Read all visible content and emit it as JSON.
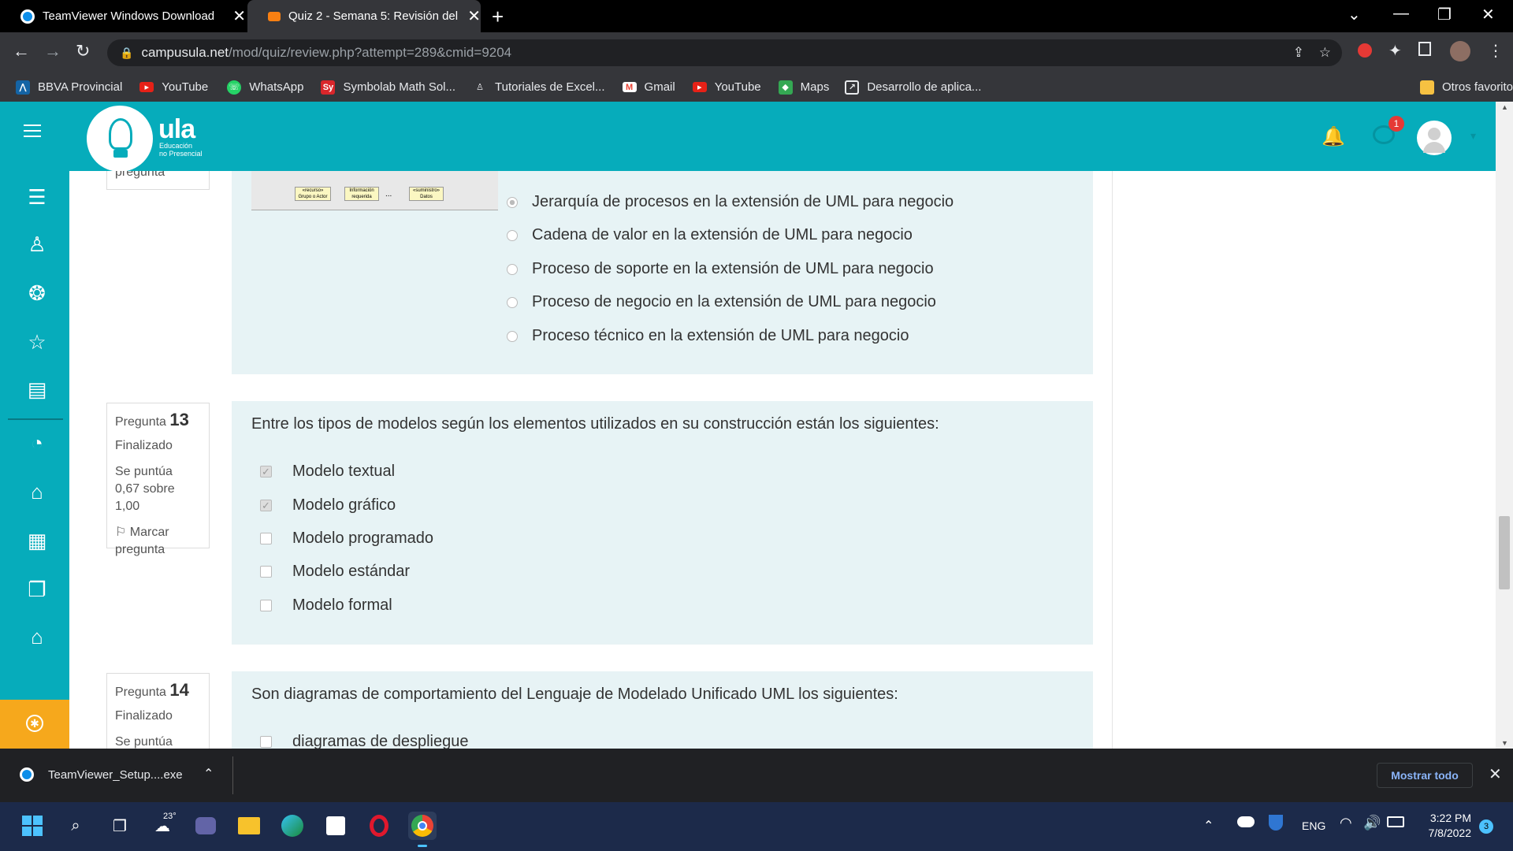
{
  "browser": {
    "tabs": [
      {
        "title": "TeamViewer Windows Download",
        "active": false
      },
      {
        "title": "Quiz 2 - Semana 5: Revisión del i",
        "active": true
      }
    ],
    "url_domain": "campusula.net",
    "url_path": "/mod/quiz/review.php?attempt=289&cmid=9204",
    "bookmarks": [
      {
        "label": "BBVA Provincial",
        "icon": "bbva-icon",
        "color": "#1464a5"
      },
      {
        "label": "YouTube",
        "icon": "youtube-icon",
        "color": "#e62117"
      },
      {
        "label": "WhatsApp",
        "icon": "whatsapp-icon",
        "color": "#25d366"
      },
      {
        "label": "Symbolab Math Sol...",
        "icon": "symbolab-icon",
        "color": "#d9262b"
      },
      {
        "label": "Tutoriales de Excel...",
        "icon": "excel-tutorial-icon",
        "color": "#444444"
      },
      {
        "label": "Gmail",
        "icon": "gmail-icon",
        "color": "#ea4335"
      },
      {
        "label": "YouTube",
        "icon": "youtube-icon",
        "color": "#e62117"
      },
      {
        "label": "Maps",
        "icon": "maps-icon",
        "color": "#34a853"
      },
      {
        "label": "Desarrollo de aplica...",
        "icon": "link-icon",
        "color": "#777777"
      }
    ],
    "other_bookmarks": "Otros favoritos"
  },
  "site": {
    "logo_text": "ula",
    "logo_sub1": "Educación",
    "logo_sub2": "no Presencial",
    "notification_count": "1",
    "brand_color": "#06acbb",
    "accent_color": "#f6a81c"
  },
  "q12": {
    "info_tail": "pregunta",
    "options": [
      {
        "text": "Jerarquía de procesos en la extensión de UML para negocio",
        "selected": true
      },
      {
        "text": "Cadena de valor en la extensión de UML para negocio",
        "selected": false
      },
      {
        "text": "Proceso de soporte en la extensión de UML para negocio",
        "selected": false
      },
      {
        "text": "Proceso de negocio en la extensión de UML para negocio",
        "selected": false
      },
      {
        "text": "Proceso técnico en la extensión de UML para negocio",
        "selected": false
      }
    ],
    "diagram_labels": [
      "«recurso» Grupo o Actor",
      "Información requerida",
      "...",
      "«suministro» Datos"
    ]
  },
  "q13": {
    "label": "Pregunta",
    "number": "13",
    "state": "Finalizado",
    "score_label": "Se puntúa",
    "score": "0,67 sobre 1,00",
    "flag_label": "Marcar",
    "flag_label2": "pregunta",
    "text": "Entre los tipos de modelos según los elementos utilizados en su construcción están los siguientes:",
    "options": [
      {
        "text": "Modelo textual",
        "checked": true
      },
      {
        "text": "Modelo gráfico",
        "checked": true
      },
      {
        "text": "Modelo programado",
        "checked": false
      },
      {
        "text": "Modelo estándar",
        "checked": false
      },
      {
        "text": "Modelo formal",
        "checked": false
      }
    ]
  },
  "q14": {
    "label": "Pregunta",
    "number": "14",
    "state": "Finalizado",
    "score_label": "Se puntúa",
    "text": "Son diagramas de comportamiento del Lenguaje de Modelado Unificado UML los siguientes:",
    "first_option": "diagramas de despliegue"
  },
  "downloads": {
    "file": "TeamViewer_Setup....exe",
    "show_all": "Mostrar todo"
  },
  "taskbar": {
    "weather": "23°",
    "lang": "ENG",
    "time": "3:22 PM",
    "date": "7/8/2022",
    "notif": "3"
  }
}
